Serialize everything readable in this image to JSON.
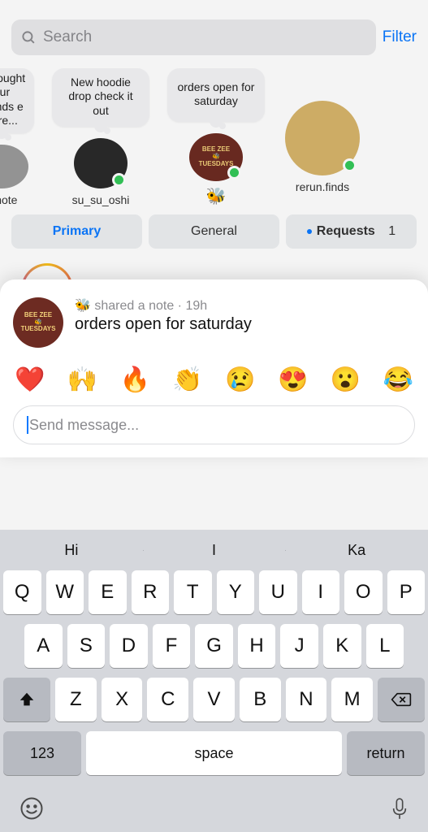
{
  "search": {
    "placeholder": "Search",
    "filter_label": "Filter"
  },
  "notes": [
    {
      "bubble": "a thought our friends e here...",
      "username": "ir note",
      "avatar_variant": "gray",
      "presence": false
    },
    {
      "bubble": "New hoodie drop check it out",
      "username": "su_su_oshi",
      "avatar_variant": "dark",
      "presence": true
    },
    {
      "bubble": "orders open for saturday",
      "username": "🐝",
      "avatar_variant": "maroon",
      "presence": true
    },
    {
      "bubble": "",
      "username": "rerun.finds",
      "avatar_variant": "tan",
      "presence": true,
      "no_bubble": true
    }
  ],
  "tabs": {
    "primary": "Primary",
    "general": "General",
    "requests": "Requests",
    "requests_count": "1"
  },
  "note_sheet": {
    "author_emoji": "🐝",
    "meta_verb": "shared a note",
    "time_ago": "19h",
    "text": "orders open for saturday",
    "avatar_label": "BEE ZEE\nTUESDAYS"
  },
  "reactions": [
    "❤️",
    "🙌",
    "🔥",
    "👏",
    "😢",
    "😍",
    "😮",
    "😂"
  ],
  "message_input": {
    "placeholder": "Send message..."
  },
  "keyboard": {
    "suggestions": [
      "Hi",
      "I",
      "Ka"
    ],
    "row1": [
      "Q",
      "W",
      "E",
      "R",
      "T",
      "Y",
      "U",
      "I",
      "O",
      "P"
    ],
    "row2": [
      "A",
      "S",
      "D",
      "F",
      "G",
      "H",
      "J",
      "K",
      "L"
    ],
    "row3": [
      "Z",
      "X",
      "C",
      "V",
      "B",
      "N",
      "M"
    ],
    "numbers_label": "123",
    "space_label": "space",
    "return_label": "return"
  }
}
